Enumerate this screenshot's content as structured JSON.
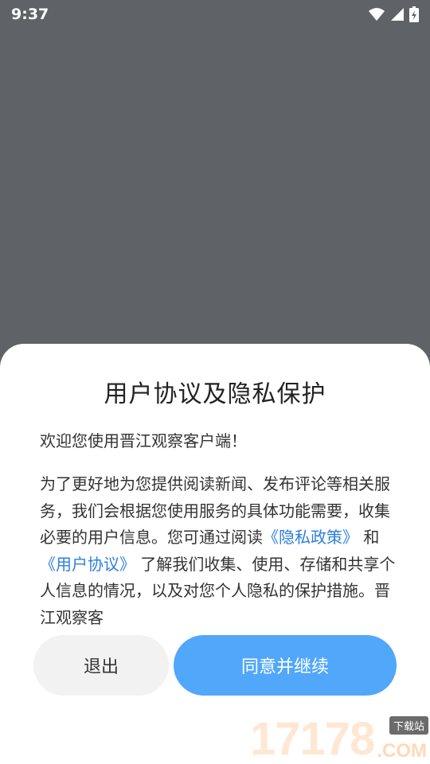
{
  "status_bar": {
    "time": "9:37"
  },
  "dialog": {
    "title": "用户协议及隐私保护",
    "welcome": "欢迎您使用晋江观察客户端！",
    "body_part1": "为了更好地为您提供阅读新闻、发布评论等相关服务，我们会根据您使用服务的具体功能需要，收集必要的用户信息。您可通过阅读",
    "privacy_link": "《隐私政策》",
    "and_text": " 和 ",
    "terms_link": "《用户协议》",
    "body_part2": " 了解我们收集、使用、存储和共享个人信息的情况，以及对您个人隐私的保护措施。晋江观察客",
    "exit_label": "退出",
    "agree_label": "同意并继续"
  },
  "watermark": {
    "digits": "17178",
    "badge": "下载站",
    "suffix": ".COM"
  },
  "colors": {
    "overlay": "#5f6367",
    "link": "#2b7fe0",
    "primary": "#51a7fa",
    "secondary": "#f2f2f2"
  }
}
